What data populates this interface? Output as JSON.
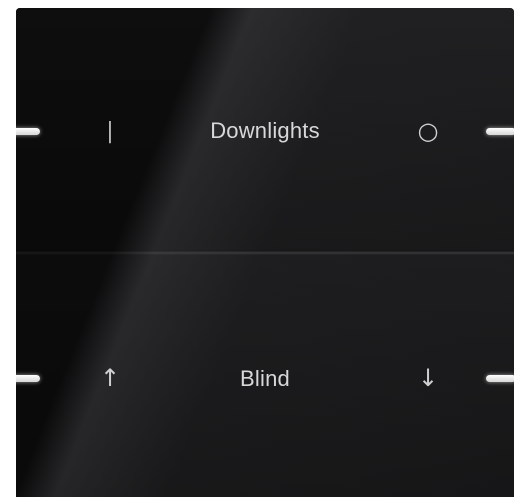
{
  "top_rocker": {
    "label": "Downlights",
    "left_symbol": "|",
    "right_symbol": "○"
  },
  "bottom_rocker": {
    "label": "Blind",
    "left_symbol": "↑",
    "right_symbol": "↓"
  },
  "colors": {
    "panel": "#1c1c1e",
    "text": "#d8d8d8",
    "led": "#ffffff"
  }
}
